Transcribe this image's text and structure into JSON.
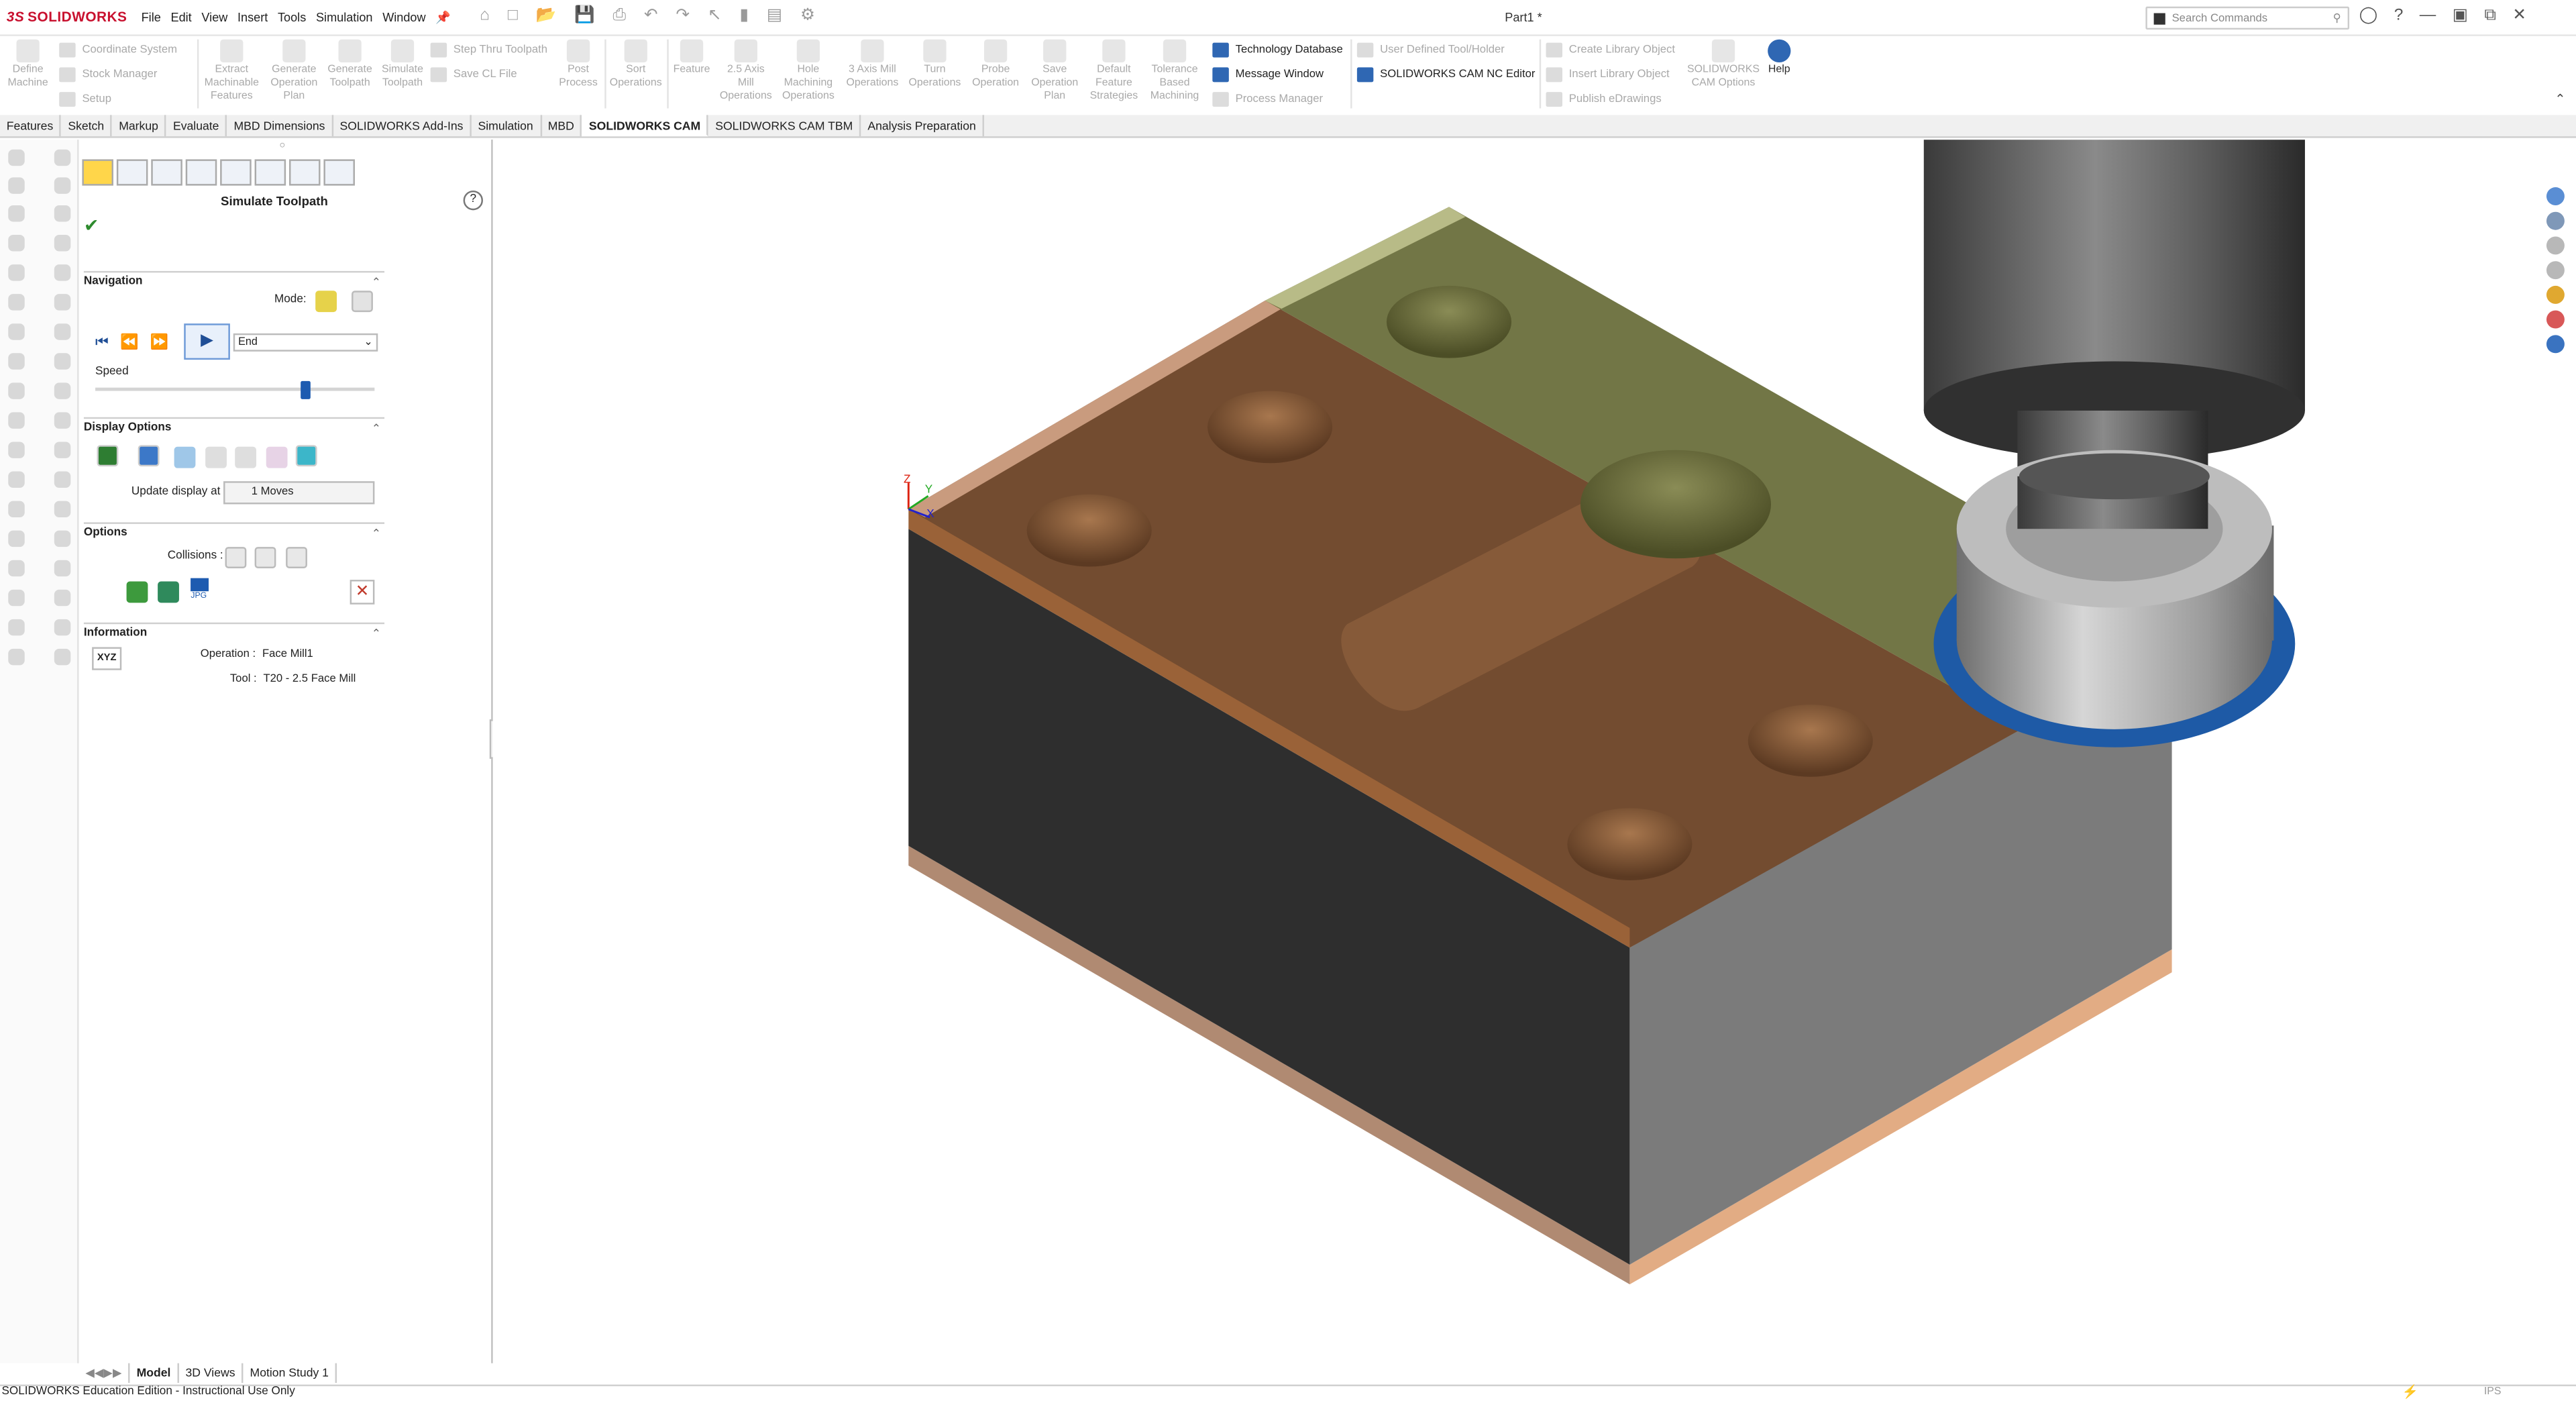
{
  "app": {
    "logo": "SOLIDWORKS",
    "logo_mark": "3S",
    "document_title": "Part1 *"
  },
  "menus": [
    "File",
    "Edit",
    "View",
    "Insert",
    "Tools",
    "Simulation",
    "Window"
  ],
  "search": {
    "placeholder": "Search Commands"
  },
  "ribbon": {
    "large": [
      {
        "label": "Define\nMachine",
        "enabled": false
      },
      {
        "label": "Extract\nMachinable\nFeatures",
        "enabled": false
      },
      {
        "label": "Generate\nOperation\nPlan",
        "enabled": false
      },
      {
        "label": "Generate\nToolpath",
        "enabled": false
      },
      {
        "label": "Simulate\nToolpath",
        "enabled": false
      },
      {
        "label": "Post\nProcess",
        "enabled": false
      },
      {
        "label": "Sort\nOperations",
        "enabled": false
      },
      {
        "label": "Feature",
        "enabled": false
      },
      {
        "label": "2.5 Axis\nMill\nOperations",
        "enabled": false
      },
      {
        "label": "Hole\nMachining\nOperations",
        "enabled": false
      },
      {
        "label": "3 Axis Mill\nOperations",
        "enabled": false
      },
      {
        "label": "Turn\nOperations",
        "enabled": false
      },
      {
        "label": "Probe\nOperation",
        "enabled": false
      },
      {
        "label": "Save\nOperation\nPlan",
        "enabled": false
      },
      {
        "label": "Default\nFeature\nStrategies",
        "enabled": false
      },
      {
        "label": "Tolerance\nBased\nMachining",
        "enabled": false
      },
      {
        "label": "SOLIDWORKS\nCAM Options",
        "enabled": false
      },
      {
        "label": "Help",
        "enabled": true
      }
    ],
    "small": [
      {
        "label": "Coordinate System",
        "enabled": false
      },
      {
        "label": "Stock Manager",
        "enabled": false
      },
      {
        "label": "Setup",
        "enabled": false
      },
      {
        "label": "Step Thru Toolpath",
        "enabled": false
      },
      {
        "label": "Save CL File",
        "enabled": false
      },
      {
        "label": "Technology Database",
        "enabled": true
      },
      {
        "label": "Message Window",
        "enabled": true
      },
      {
        "label": "Process Manager",
        "enabled": false
      },
      {
        "label": "User Defined Tool/Holder",
        "enabled": false
      },
      {
        "label": "SOLIDWORKS CAM NC Editor",
        "enabled": true
      },
      {
        "label": "Create Library Object",
        "enabled": false
      },
      {
        "label": "Insert Library Object",
        "enabled": false
      },
      {
        "label": "Publish eDrawings",
        "enabled": false
      }
    ]
  },
  "tabs": [
    {
      "label": "Features",
      "active": false
    },
    {
      "label": "Sketch",
      "active": false
    },
    {
      "label": "Markup",
      "active": false
    },
    {
      "label": "Evaluate",
      "active": false
    },
    {
      "label": "MBD Dimensions",
      "active": false
    },
    {
      "label": "SOLIDWORKS Add-Ins",
      "active": false
    },
    {
      "label": "Simulation",
      "active": false
    },
    {
      "label": "MBD",
      "active": false
    },
    {
      "label": "SOLIDWORKS CAM",
      "active": true
    },
    {
      "label": "SOLIDWORKS CAM TBM",
      "active": false
    },
    {
      "label": "Analysis Preparation",
      "active": false
    }
  ],
  "panel": {
    "title": "Simulate Toolpath",
    "navigation": {
      "heading": "Navigation",
      "mode_label": "Mode:",
      "dropdown_value": "End",
      "speed_label": "Speed",
      "speed_fraction": 0.75
    },
    "display": {
      "heading": "Display Options",
      "update_label": "Update display at :",
      "update_value": "1 Moves"
    },
    "options": {
      "heading": "Options",
      "collisions_label": "Collisions :",
      "jpg_label": "JPG"
    },
    "information": {
      "heading": "Information",
      "xyz_label": "XYZ",
      "operation_label": "Operation :",
      "operation_value": "Face Mill1",
      "tool_label": "Tool :",
      "tool_value": "T20 - 2.5 Face Mill"
    }
  },
  "bottom_tabs": [
    {
      "label": "Model",
      "active": true
    },
    {
      "label": "3D Views",
      "active": false
    },
    {
      "label": "Motion Study 1",
      "active": false
    }
  ],
  "status": {
    "text": "SOLIDWORKS Education Edition - Instructional Use Only",
    "units": "IPS"
  },
  "triad": {
    "z_label": "Z",
    "y_label": "Y",
    "x_label": "X"
  },
  "colors": {
    "accent": "#2f67b3",
    "stock_top": "#734c30",
    "stock_face_dark": "#2e2e2e",
    "stock_face_light": "#7b7b7b",
    "copper_edge": "#d9a27b",
    "toolpath_green": "#666a36",
    "tool_ring_blue": "#1e5aa6"
  }
}
